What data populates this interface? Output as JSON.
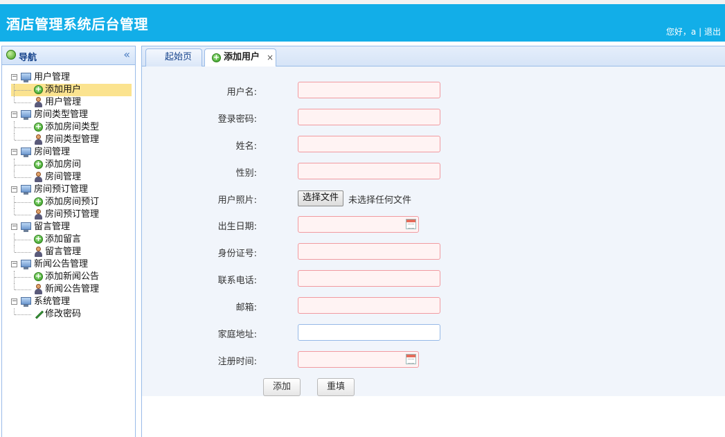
{
  "header": {
    "title": "酒店管理系统后台管理",
    "greeting": "您好，a",
    "separator": "|",
    "logout": "退出"
  },
  "nav": {
    "title": "导航",
    "collapse_glyph": "«",
    "tree": [
      {
        "label": "用户管理",
        "children": [
          {
            "label": "添加用户",
            "icon": "add-icon",
            "selected": true
          },
          {
            "label": "用户管理",
            "icon": "user-icon"
          }
        ]
      },
      {
        "label": "房间类型管理",
        "children": [
          {
            "label": "添加房间类型",
            "icon": "add-icon"
          },
          {
            "label": "房间类型管理",
            "icon": "user-icon"
          }
        ]
      },
      {
        "label": "房间管理",
        "children": [
          {
            "label": "添加房间",
            "icon": "add-icon"
          },
          {
            "label": "房间管理",
            "icon": "user-icon"
          }
        ]
      },
      {
        "label": "房间预订管理",
        "children": [
          {
            "label": "添加房间预订",
            "icon": "add-icon"
          },
          {
            "label": "房间预订管理",
            "icon": "user-icon"
          }
        ]
      },
      {
        "label": "留言管理",
        "children": [
          {
            "label": "添加留言",
            "icon": "add-icon"
          },
          {
            "label": "留言管理",
            "icon": "user-icon"
          }
        ]
      },
      {
        "label": "新闻公告管理",
        "children": [
          {
            "label": "添加新闻公告",
            "icon": "add-icon"
          },
          {
            "label": "新闻公告管理",
            "icon": "user-icon"
          }
        ]
      },
      {
        "label": "系统管理",
        "children": [
          {
            "label": "修改密码",
            "icon": "pencil-icon"
          }
        ]
      }
    ]
  },
  "tabs": {
    "home": "起始页",
    "active": "添加用户",
    "close": "×"
  },
  "form": {
    "fields": {
      "username": {
        "label": "用户名:",
        "value": ""
      },
      "password": {
        "label": "登录密码:",
        "value": ""
      },
      "name": {
        "label": "姓名:",
        "value": ""
      },
      "gender": {
        "label": "性别:",
        "value": ""
      },
      "photo": {
        "label": "用户照片:",
        "button": "选择文件",
        "status": "未选择任何文件"
      },
      "birthday": {
        "label": "出生日期:",
        "value": ""
      },
      "idcard": {
        "label": "身份证号:",
        "value": ""
      },
      "phone": {
        "label": "联系电话:",
        "value": ""
      },
      "email": {
        "label": "邮箱:",
        "value": ""
      },
      "address": {
        "label": "家庭地址:",
        "value": ""
      },
      "regtime": {
        "label": "注册时间:",
        "value": ""
      }
    },
    "submit": "添加",
    "reset": "重填"
  },
  "colors": {
    "header_bg": "#12aee8",
    "invalid_border": "#f19aa0",
    "invalid_bg": "#fff3f3",
    "selected_bg": "#fbe38f"
  }
}
